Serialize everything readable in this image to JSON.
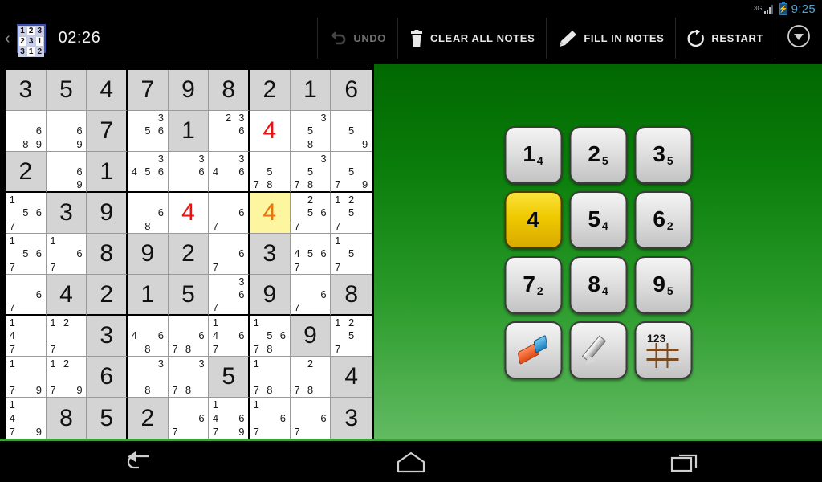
{
  "status_bar": {
    "network": "3G",
    "network_icon": "signal-bars-icon",
    "battery_icon": "battery-charging-icon",
    "clock": "9:25"
  },
  "action_bar": {
    "back_caret": "‹",
    "app_icon": "sudoku-logo-icon",
    "app_icon_grid": [
      "1",
      "2",
      "3",
      "2",
      "3",
      "1",
      "3",
      "1",
      "2"
    ],
    "timer": "02:26",
    "items": [
      {
        "label": "UNDO",
        "icon": "undo-icon",
        "enabled": false
      },
      {
        "label": "CLEAR ALL NOTES",
        "icon": "trash-icon",
        "enabled": true
      },
      {
        "label": "FILL IN NOTES",
        "icon": "pencil-icon",
        "enabled": true
      },
      {
        "label": "RESTART",
        "icon": "restart-icon",
        "enabled": true
      }
    ],
    "overflow_icon": "chevron-down-circle-icon"
  },
  "board": {
    "selected_cell": {
      "row": 4,
      "col": 7
    },
    "colors": {
      "given_background": "#d4d4d4",
      "empty_background": "#ffffff",
      "selected_background": "#fdf59f",
      "given_text": "#111111",
      "user_text": "#ee1111",
      "selected_text": "#e8770b",
      "note_text": "#1a1a1a"
    },
    "cells": [
      [
        {
          "v": "3",
          "t": "given"
        },
        {
          "v": "5",
          "t": "given"
        },
        {
          "v": "4",
          "t": "given"
        },
        {
          "v": "7",
          "t": "given"
        },
        {
          "v": "9",
          "t": "given"
        },
        {
          "v": "8",
          "t": "given"
        },
        {
          "v": "2",
          "t": "given"
        },
        {
          "v": "1",
          "t": "given"
        },
        {
          "v": "6",
          "t": "given"
        }
      ],
      [
        {
          "notes": [
            6,
            8,
            9
          ]
        },
        {
          "notes": [
            6,
            9
          ]
        },
        {
          "v": "7",
          "t": "given"
        },
        {
          "notes": [
            3,
            5,
            6
          ]
        },
        {
          "v": "1",
          "t": "given"
        },
        {
          "notes": [
            2,
            3,
            6
          ]
        },
        {
          "v": "4",
          "t": "user"
        },
        {
          "notes": [
            3,
            5,
            8
          ]
        },
        {
          "notes": [
            5,
            9
          ]
        }
      ],
      [
        {
          "v": "2",
          "t": "given"
        },
        {
          "notes": [
            6,
            9
          ]
        },
        {
          "v": "1",
          "t": "given"
        },
        {
          "notes": [
            3,
            4,
            5,
            6
          ]
        },
        {
          "notes": [
            3,
            6
          ]
        },
        {
          "notes": [
            3,
            4,
            6
          ]
        },
        {
          "notes": [
            5,
            7,
            8
          ]
        },
        {
          "notes": [
            3,
            5,
            7,
            8
          ]
        },
        {
          "notes": [
            5,
            7,
            9
          ]
        }
      ],
      [
        {
          "notes": [
            1,
            5,
            6,
            7
          ]
        },
        {
          "v": "3",
          "t": "given"
        },
        {
          "v": "9",
          "t": "given"
        },
        {
          "notes": [
            6,
            8
          ]
        },
        {
          "v": "4",
          "t": "user"
        },
        {
          "notes": [
            6,
            7
          ]
        },
        {
          "v": "4",
          "t": "selected"
        },
        {
          "notes": [
            2,
            5,
            6,
            7
          ]
        },
        {
          "notes": [
            1,
            2,
            5,
            7
          ]
        }
      ],
      [
        {
          "notes": [
            1,
            5,
            6,
            7
          ]
        },
        {
          "notes": [
            1,
            6,
            7
          ]
        },
        {
          "v": "8",
          "t": "given"
        },
        {
          "v": "9",
          "t": "given"
        },
        {
          "v": "2",
          "t": "given"
        },
        {
          "notes": [
            6,
            7
          ]
        },
        {
          "v": "3",
          "t": "given"
        },
        {
          "notes": [
            4,
            5,
            6,
            7
          ]
        },
        {
          "notes": [
            1,
            5,
            7
          ]
        }
      ],
      [
        {
          "notes": [
            6,
            7
          ]
        },
        {
          "v": "4",
          "t": "given"
        },
        {
          "v": "2",
          "t": "given"
        },
        {
          "v": "1",
          "t": "given"
        },
        {
          "v": "5",
          "t": "given"
        },
        {
          "notes": [
            3,
            6,
            7
          ]
        },
        {
          "v": "9",
          "t": "given"
        },
        {
          "notes": [
            6,
            7
          ]
        },
        {
          "v": "8",
          "t": "given"
        }
      ],
      [
        {
          "notes": [
            1,
            4,
            7
          ]
        },
        {
          "notes": [
            1,
            2,
            7
          ]
        },
        {
          "v": "3",
          "t": "given"
        },
        {
          "notes": [
            4,
            6,
            8
          ]
        },
        {
          "notes": [
            6,
            7,
            8
          ]
        },
        {
          "notes": [
            1,
            4,
            6,
            7
          ]
        },
        {
          "notes": [
            1,
            5,
            6,
            7,
            8
          ]
        },
        {
          "v": "9",
          "t": "given"
        },
        {
          "notes": [
            1,
            2,
            5,
            7
          ]
        }
      ],
      [
        {
          "notes": [
            1,
            7,
            9
          ]
        },
        {
          "notes": [
            1,
            2,
            7,
            9
          ]
        },
        {
          "v": "6",
          "t": "given"
        },
        {
          "notes": [
            3,
            8
          ]
        },
        {
          "notes": [
            3,
            7,
            8
          ]
        },
        {
          "v": "5",
          "t": "given"
        },
        {
          "notes": [
            1,
            7,
            8
          ]
        },
        {
          "notes": [
            2,
            7,
            8
          ]
        },
        {
          "v": "4",
          "t": "given"
        }
      ],
      [
        {
          "notes": [
            1,
            4,
            7,
            9
          ]
        },
        {
          "v": "8",
          "t": "given"
        },
        {
          "v": "5",
          "t": "given"
        },
        {
          "v": "2",
          "t": "given"
        },
        {
          "notes": [
            6,
            7
          ]
        },
        {
          "notes": [
            1,
            4,
            6,
            7,
            9
          ]
        },
        {
          "notes": [
            1,
            6,
            7
          ]
        },
        {
          "notes": [
            6,
            7
          ]
        },
        {
          "v": "3",
          "t": "given"
        }
      ]
    ]
  },
  "keypad": {
    "selected_digit": "4",
    "keys": [
      {
        "digit": "1",
        "remaining": "4",
        "name": "digit-1",
        "state": "normal"
      },
      {
        "digit": "2",
        "remaining": "5",
        "name": "digit-2",
        "state": "normal"
      },
      {
        "digit": "3",
        "remaining": "5",
        "name": "digit-3",
        "state": "normal"
      },
      {
        "digit": "4",
        "remaining": "",
        "name": "digit-4",
        "state": "active"
      },
      {
        "digit": "5",
        "remaining": "4",
        "name": "digit-5",
        "state": "normal"
      },
      {
        "digit": "6",
        "remaining": "2",
        "name": "digit-6",
        "state": "normal"
      },
      {
        "digit": "7",
        "remaining": "2",
        "name": "digit-7",
        "state": "normal"
      },
      {
        "digit": "8",
        "remaining": "4",
        "name": "digit-8",
        "state": "normal"
      },
      {
        "digit": "9",
        "remaining": "5",
        "name": "digit-9",
        "state": "normal"
      }
    ],
    "tools": [
      {
        "name": "eraser-button",
        "icon": "eraser-icon"
      },
      {
        "name": "pencil-button",
        "icon": "pencil-icon"
      },
      {
        "name": "notes-grid-button",
        "icon": "notes-grid-icon",
        "label": "123"
      }
    ],
    "background_top_color": "#016801",
    "background_bottom_color": "#63bb63"
  },
  "nav_bar": {
    "buttons": [
      {
        "name": "nav-back",
        "icon": "back-arrow-icon"
      },
      {
        "name": "nav-home",
        "icon": "home-icon"
      },
      {
        "name": "nav-recents",
        "icon": "recents-icon"
      }
    ]
  }
}
